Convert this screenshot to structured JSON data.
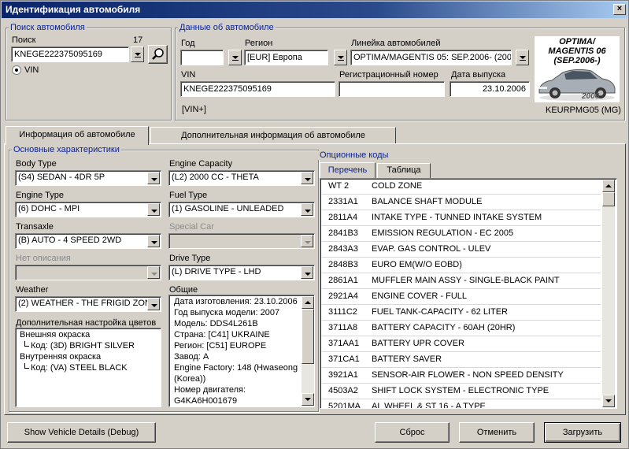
{
  "window": {
    "title": "Идентификация автомобиля",
    "close_glyph": "×"
  },
  "search": {
    "legend": "Поиск автомобиля",
    "label": "Поиск",
    "count": "17",
    "value": "KNEGE222375095169",
    "vin_label": "VIN"
  },
  "vehicle": {
    "legend": "Данные об автомобиле",
    "year_label": "Год",
    "year_value": "",
    "region_label": "Регион",
    "region_value": "[EUR]  Европа",
    "line_label": "Линейка автомобилей",
    "line_value": "OPTIMA/MAGENTIS 05: SEP.2006- (200",
    "vin_label": "VIN",
    "vin_value": "KNEGE222375095169",
    "reg_label": "Регистрационный номер",
    "reg_value": "",
    "date_label": "Дата выпуска",
    "date_value": "23.10.2006",
    "vin_plus": "[VIN+]",
    "model_code": "KEURPMG05 (MG)",
    "image_caption_1": "OPTIMA/",
    "image_caption_2": "MAGENTIS 06",
    "image_caption_3": "(SEP.2006-)",
    "image_year": "2006"
  },
  "tabs": [
    {
      "label": "Информация об автомобиле"
    },
    {
      "label": "Дополнительная информация об автомобиле"
    }
  ],
  "main": {
    "legend": "Основные характеристики",
    "body_type_label": "Body Type",
    "body_type_value": "(S4) SEDAN - 4DR 5P",
    "engine_cap_label": "Engine Capacity",
    "engine_cap_value": "(L2) 2000 CC - THETA",
    "engine_type_label": "Engine Type",
    "engine_type_value": "(6) DOHC - MPI",
    "fuel_label": "Fuel Type",
    "fuel_value": "(1) GASOLINE - UNLEADED",
    "transaxle_label": "Transaxle",
    "transaxle_value": "(B) AUTO - 4 SPEED 2WD",
    "special_label": "Special Car",
    "special_value": "",
    "nodesc_label": "Нет описания",
    "nodesc_value": "",
    "drive_label": "Drive Type",
    "drive_value": "(L) DRIVE TYPE - LHD",
    "weather_label": "Weather",
    "weather_value": "(2) WEATHER - THE FRIGID ZON",
    "general_label": "Общие",
    "general_lines": [
      "Дата изготовления: 23.10.2006",
      "Год выпуска модели: 2007",
      "Модель: DDS4L261B",
      "Страна: [C41]  UKRAINE",
      "Регион: [C51]  EUROPE",
      "Завод: A",
      "Engine Factory: 148 (Hwaseong",
      "(Korea))",
      "Номер двигателя:",
      "G4KA6H001679"
    ],
    "colors_label": "Дополнительная настройка цветов",
    "colors": {
      "exterior_label": "Внешняя окраска",
      "exterior_code": "Код: (3D) BRIGHT SILVER",
      "interior_label": "Внутренняя окраска",
      "interior_code": "Код: (VA) STEEL BLACK"
    }
  },
  "options": {
    "legend": "Опционные коды",
    "tab_list": "Перечень",
    "tab_table": "Таблица",
    "rows": [
      {
        "code": "WT  2",
        "desc": "COLD ZONE"
      },
      {
        "code": "2331A1",
        "desc": "BALANCE SHAFT MODULE"
      },
      {
        "code": "2811A4",
        "desc": "INTAKE TYPE - TUNNED INTAKE SYSTEM"
      },
      {
        "code": "2841B3",
        "desc": "EMISSION REGULATION - EC 2005"
      },
      {
        "code": "2843A3",
        "desc": "EVAP. GAS CONTROL - ULEV"
      },
      {
        "code": "2848B3",
        "desc": "EURO EM(W/O EOBD)"
      },
      {
        "code": "2861A1",
        "desc": "MUFFLER MAIN ASSY - SINGLE-BLACK PAINT"
      },
      {
        "code": "2921A4",
        "desc": "ENGINE COVER - FULL"
      },
      {
        "code": "3111C2",
        "desc": "FUEL TANK-CAPACITY - 62 LITER"
      },
      {
        "code": "3711A8",
        "desc": "BATTERY CAPACITY - 60AH (20HR)"
      },
      {
        "code": "371AA1",
        "desc": "BATTERY UPR COVER"
      },
      {
        "code": "371CA1",
        "desc": "BATTERY SAVER"
      },
      {
        "code": "3921A1",
        "desc": "SENSOR-AIR FLOWER - NON SPEED DENSITY"
      },
      {
        "code": "4503A2",
        "desc": "SHIFT LOCK SYSTEM - ELECTRONIC TYPE"
      },
      {
        "code": "5201MA",
        "desc": "AL WHEEL & ST 16 - A TYPE"
      }
    ]
  },
  "buttons": {
    "debug": "Show Vehicle Details (Debug)",
    "reset": "Сброс",
    "cancel": "Отменить",
    "load": "Загрузить"
  }
}
